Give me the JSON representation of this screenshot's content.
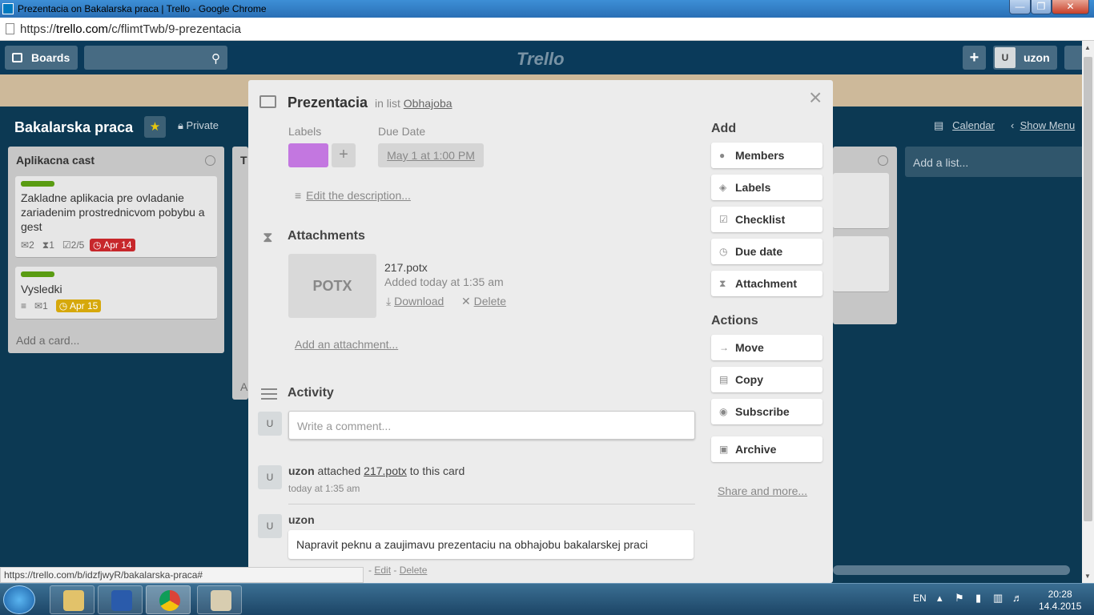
{
  "window": {
    "title": "Prezentacia on Bakalarska praca | Trello - Google Chrome",
    "min": "—",
    "max": "❐",
    "close": "✕"
  },
  "address": {
    "scheme": "https://",
    "domain": "trello.com",
    "path": "/c/flimtTwb/9-prezentacia"
  },
  "header": {
    "boards": "Boards",
    "logo": "Trello",
    "plus": "+",
    "avatar": "U",
    "user": "uzon"
  },
  "board": {
    "name": "Bakalarska praca",
    "star": "★",
    "private": "Private",
    "calendar": "Calendar",
    "show_menu": "Show Menu",
    "add_list": "Add a list..."
  },
  "list1": {
    "title": "Aplikacna cast",
    "cards": [
      {
        "text": "Zakladne aplikacia pre ovladanie zariadenim prostrednicvom pobybu a gest",
        "comments": "2",
        "attachments": "1",
        "checklist": "2/5",
        "due": "Apr 14"
      },
      {
        "text": "Vysledki",
        "comments": "1",
        "due": "Apr 15"
      }
    ],
    "add_card": "Add a card..."
  },
  "list2": {
    "title": "T",
    "add_card": "A"
  },
  "modal": {
    "title": "Prezentacia",
    "in_list": "in list",
    "list_name": "Obhajoba",
    "labels_label": "Labels",
    "due_label": "Due Date",
    "label_add": "+",
    "due_date": "May 1 at 1:00 PM",
    "edit_description": "Edit the description...",
    "attachments_title": "Attachments",
    "attachment": {
      "thumb": "POTX",
      "name": "217.potx",
      "added": "Added today at 1:35 am",
      "download": "Download",
      "delete": "Delete"
    },
    "add_attachment": "Add an attachment...",
    "activity_title": "Activity",
    "avatar": "U",
    "comment_placeholder": "Write a comment...",
    "activity": [
      {
        "user": "uzon",
        "action": "attached",
        "link": "217.potx",
        "rest": "to this card",
        "time": "today at 1:35 am"
      },
      {
        "user": "uzon",
        "comment": "Napravit peknu a zaujimavu prezentaciu na obhajobu bakalarskej praci",
        "edit": "Edit",
        "delete": "Delete"
      }
    ],
    "close": "×"
  },
  "sidebar": {
    "add_title": "Add",
    "add_buttons": [
      {
        "label": "Members",
        "icon": "person-icon"
      },
      {
        "label": "Labels",
        "icon": "tag-icon"
      },
      {
        "label": "Checklist",
        "icon": "checkbox-icon"
      },
      {
        "label": "Due date",
        "icon": "clock-icon"
      },
      {
        "label": "Attachment",
        "icon": "paperclip-icon"
      }
    ],
    "actions_title": "Actions",
    "action_buttons": [
      {
        "label": "Move",
        "icon": "arrow-right-icon"
      },
      {
        "label": "Copy",
        "icon": "copy-icon"
      },
      {
        "label": "Subscribe",
        "icon": "eye-icon"
      },
      {
        "label": "Archive",
        "icon": "archive-icon"
      }
    ],
    "share": "Share and more..."
  },
  "status_url": "https://trello.com/b/idzfjwyR/bakalarska-praca#",
  "taskbar": {
    "lang": "EN",
    "time": "20:28",
    "date": "14.4.2015"
  },
  "colors": {
    "label": "#c377e0",
    "due_red": "#c7272b",
    "due_yellow": "#d6a80b",
    "green_label": "#5a9c12"
  }
}
